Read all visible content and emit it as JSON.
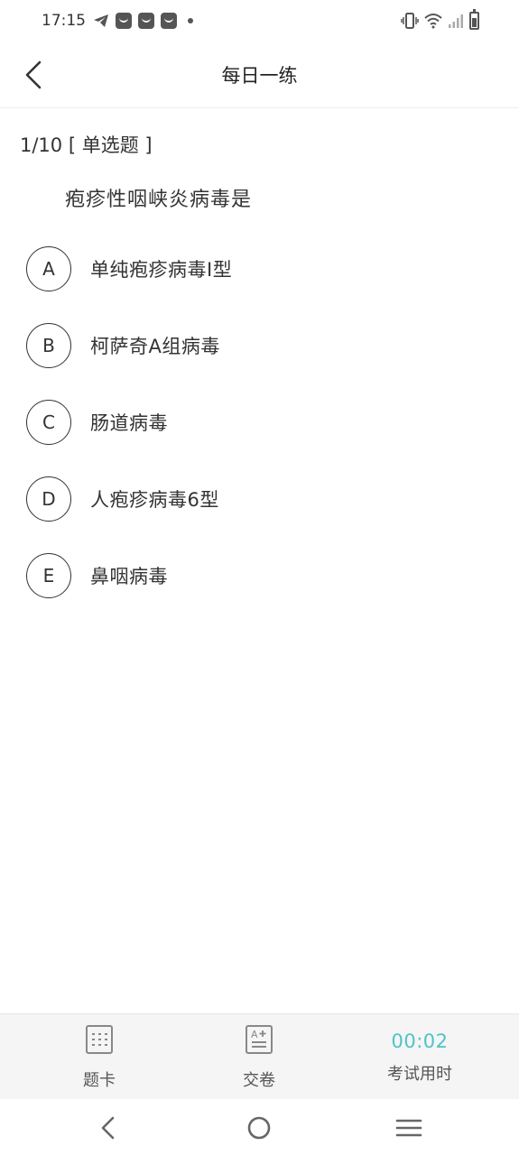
{
  "status_bar": {
    "time": "17:15",
    "icons": [
      "telegram-icon",
      "notification-icon",
      "notification-icon",
      "notification-icon",
      "dot-icon",
      "vibrate-icon",
      "wifi-icon",
      "signal-icon",
      "battery-icon"
    ]
  },
  "header": {
    "title": "每日一练",
    "back_icon": "chevron-left-icon"
  },
  "question": {
    "progress": "1/10",
    "type": "[ 单选题 ]",
    "text": "疱疹性咽峡炎病毒是",
    "options": [
      {
        "letter": "A",
        "text": "单纯疱疹病毒I型"
      },
      {
        "letter": "B",
        "text": "柯萨奇A组病毒"
      },
      {
        "letter": "C",
        "text": "肠道病毒"
      },
      {
        "letter": "D",
        "text": "人疱疹病毒6型"
      },
      {
        "letter": "E",
        "text": "鼻咽病毒"
      }
    ]
  },
  "bottom_bar": {
    "answer_card_label": "题卡",
    "submit_label": "交卷",
    "timer_value": "00:02",
    "timer_label": "考试用时"
  },
  "colors": {
    "accent": "#4fc3c7",
    "text": "#333333",
    "bottom_bar_bg": "#f5f5f5"
  },
  "nav_bar": {
    "icons": [
      "nav-back-icon",
      "nav-home-icon",
      "nav-menu-icon"
    ]
  }
}
